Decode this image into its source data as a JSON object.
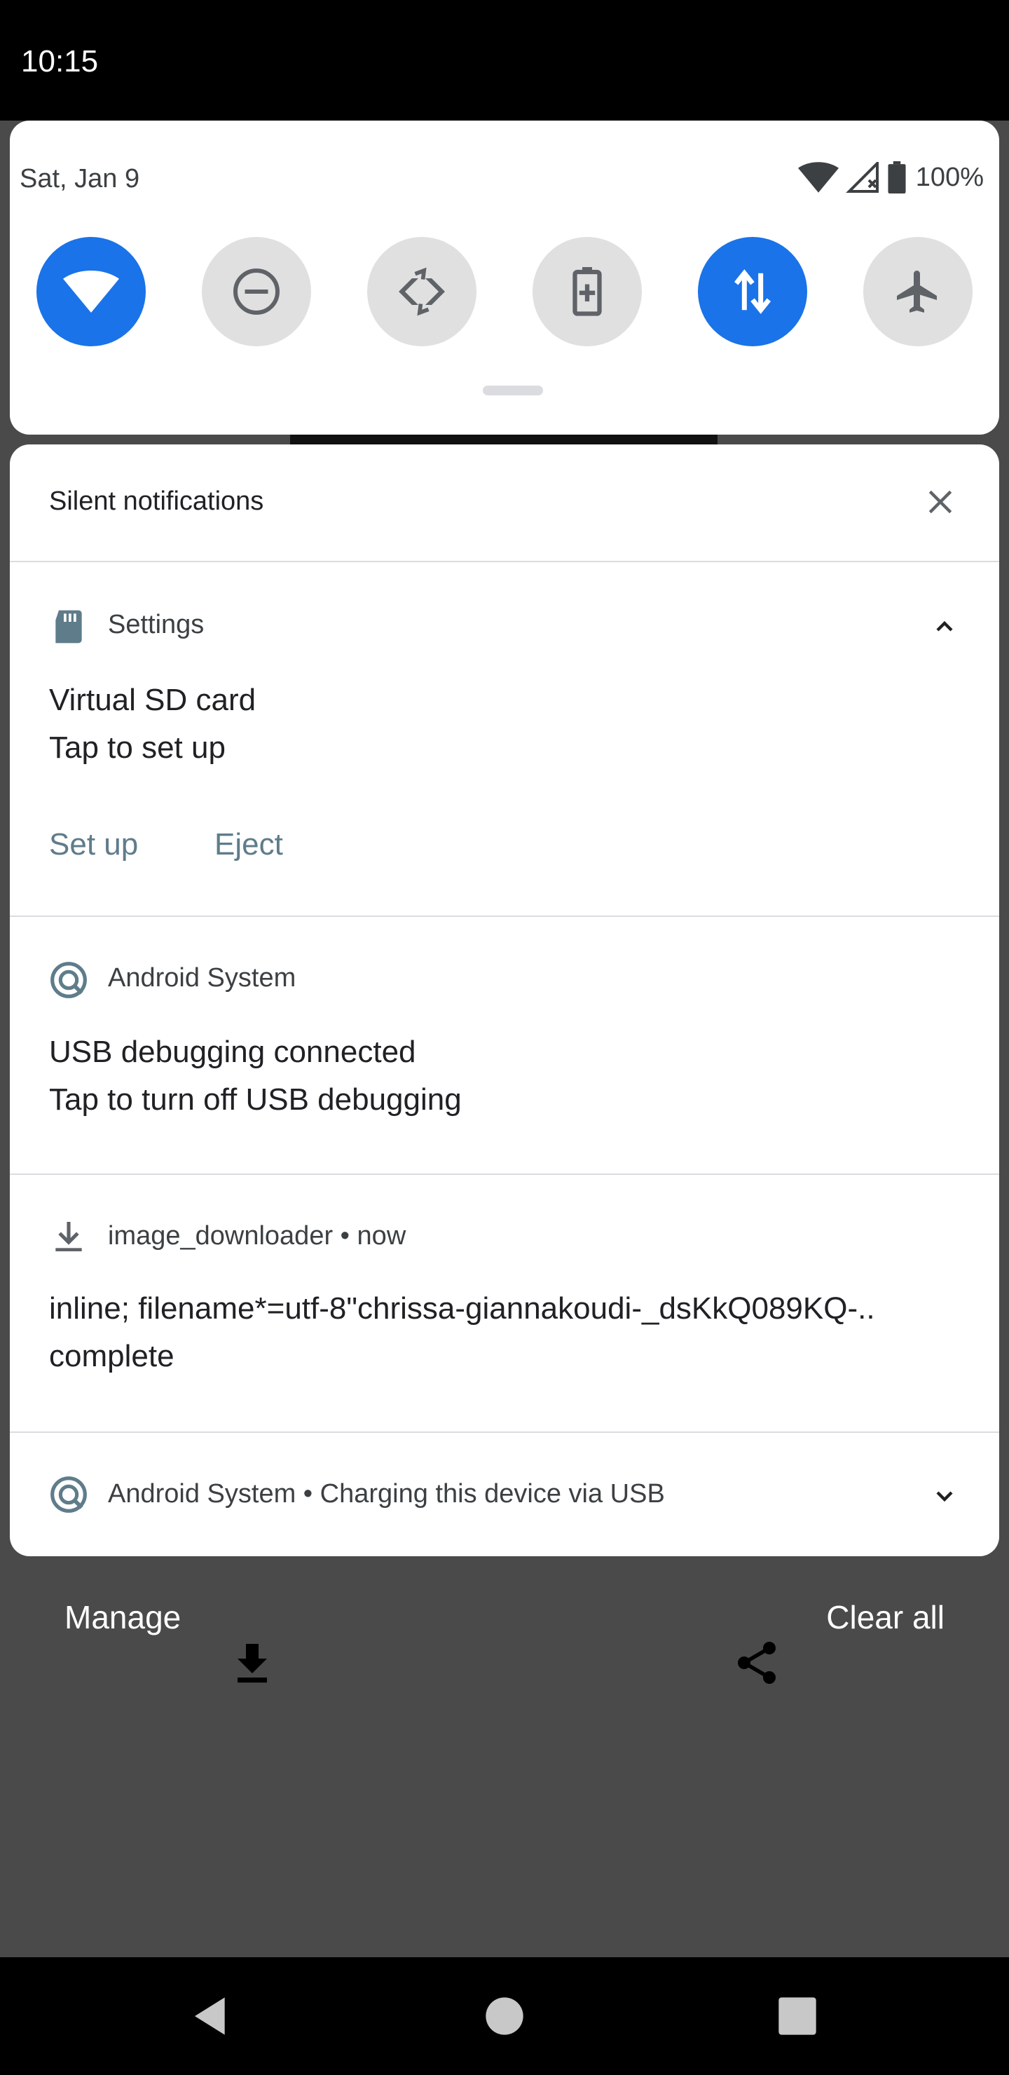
{
  "status_bar": {
    "time": "10:15"
  },
  "quick_settings": {
    "date": "Sat, Jan 9",
    "battery_percent": "100%",
    "tiles": [
      {
        "name": "wifi",
        "icon": "wifi-icon",
        "state": "on"
      },
      {
        "name": "do-not-disturb",
        "icon": "do-not-disturb-icon",
        "state": "off"
      },
      {
        "name": "auto-rotate",
        "icon": "auto-rotate-icon",
        "state": "off"
      },
      {
        "name": "battery-saver",
        "icon": "battery-saver-icon",
        "state": "off"
      },
      {
        "name": "mobile-data",
        "icon": "mobile-data-icon",
        "state": "on"
      },
      {
        "name": "airplane-mode",
        "icon": "airplane-icon",
        "state": "off"
      }
    ],
    "active_color": "#1a73e8",
    "inactive_color": "#e0e0e0"
  },
  "shade": {
    "section_title": "Silent notifications",
    "notifications": [
      {
        "app": "Settings",
        "icon": "sd-card-icon",
        "title": "Virtual SD card",
        "text": "Tap to set up",
        "actions": [
          "Set up",
          "Eject"
        ],
        "expanded": true
      },
      {
        "app": "Android System",
        "icon": "android-system-icon",
        "title": "USB debugging connected",
        "text": "Tap to turn off USB debugging"
      },
      {
        "app": "image_downloader",
        "time": "now",
        "icon": "download-icon",
        "title": "inline; filename*=utf-8\"chrissa-giannakoudi-_dsKkQ089KQ-..",
        "text": "complete"
      },
      {
        "app": "Android System",
        "summary": "Charging this device via USB",
        "icon": "android-system-icon",
        "expanded": false
      }
    ],
    "action_color": "#5f7c8a"
  },
  "footer": {
    "manage": "Manage",
    "clear_all": "Clear all"
  }
}
